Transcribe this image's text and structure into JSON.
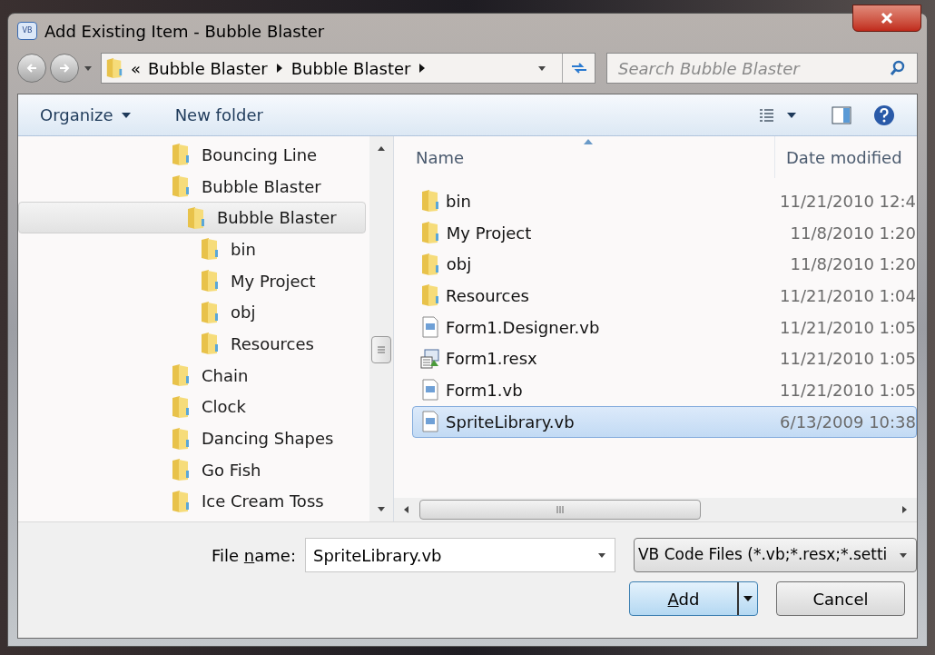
{
  "window": {
    "icon_text": "VB",
    "title": "Add Existing Item - Bubble Blaster"
  },
  "address": {
    "overflow": "«",
    "crumbs": [
      "Bubble Blaster",
      "Bubble Blaster"
    ]
  },
  "search": {
    "placeholder": "Search Bubble Blaster"
  },
  "toolbar": {
    "items": [
      "Organize",
      "New folder"
    ]
  },
  "tree": [
    {
      "label": "Bouncing Line",
      "selected": false
    },
    {
      "label": "Bubble Blaster",
      "selected": false,
      "children": [
        {
          "label": "Bubble Blaster",
          "selected": true,
          "children": [
            {
              "label": "bin",
              "selected": false
            },
            {
              "label": "My Project",
              "selected": false
            },
            {
              "label": "obj",
              "selected": false
            },
            {
              "label": "Resources",
              "selected": false
            }
          ]
        }
      ]
    },
    {
      "label": "Chain",
      "selected": false
    },
    {
      "label": "Clock",
      "selected": false
    },
    {
      "label": "Dancing Shapes",
      "selected": false
    },
    {
      "label": "Go Fish",
      "selected": false
    },
    {
      "label": "Ice Cream Toss",
      "selected": false
    }
  ],
  "file_list": {
    "columns": [
      "Name",
      "Date modified"
    ],
    "rows": [
      {
        "name": "bin",
        "date": "11/21/2010 12:4",
        "kind": "folder",
        "selected": false
      },
      {
        "name": "My Project",
        "date": "11/8/2010 1:20",
        "kind": "folder",
        "selected": false
      },
      {
        "name": "obj",
        "date": "11/8/2010 1:20",
        "kind": "folder",
        "selected": false
      },
      {
        "name": "Resources",
        "date": "11/21/2010 1:04",
        "kind": "folder",
        "selected": false
      },
      {
        "name": "Form1.Designer.vb",
        "date": "11/21/2010 1:05",
        "kind": "code",
        "selected": false
      },
      {
        "name": "Form1.resx",
        "date": "11/21/2010 1:05",
        "kind": "resource",
        "selected": false
      },
      {
        "name": "Form1.vb",
        "date": "11/21/2010 1:05",
        "kind": "code",
        "selected": false
      },
      {
        "name": "SpriteLibrary.vb",
        "date": "6/13/2009 10:38",
        "kind": "code",
        "selected": true
      }
    ]
  },
  "file_name": {
    "label": {
      "before": "File ",
      "key": "n",
      "after": "ame:"
    },
    "value": "SpriteLibrary.vb"
  },
  "file_type": {
    "value": "VB Code Files (*.vb;*.resx;*.setti"
  },
  "buttons": [
    {
      "label": {
        "key": "A",
        "after": "dd"
      },
      "kind": "split"
    },
    {
      "label": {
        "after": "Cancel"
      },
      "kind": "plain"
    }
  ]
}
